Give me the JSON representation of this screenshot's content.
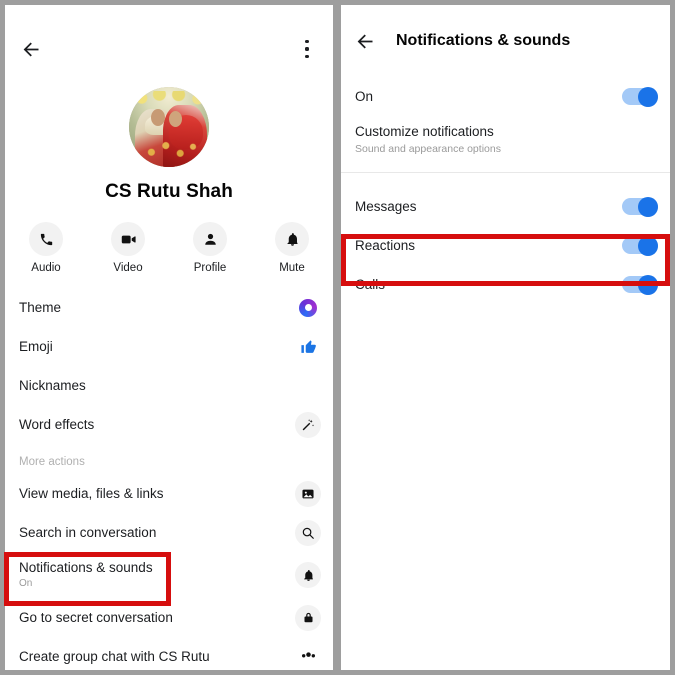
{
  "left_panel": {
    "topbar": {
      "back_icon": "arrow-left-icon",
      "overflow_icon": "more-vertical-icon"
    },
    "profile": {
      "avatar_alt": "wedding-photo-avatar",
      "name": "CS Rutu Shah"
    },
    "quick_actions": [
      {
        "label": "Audio",
        "icon": "phone-icon"
      },
      {
        "label": "Video",
        "icon": "video-camera-icon"
      },
      {
        "label": "Profile",
        "icon": "person-icon"
      },
      {
        "label": "Mute",
        "icon": "bell-icon"
      }
    ],
    "items": [
      {
        "label": "Theme",
        "icon": "theme-color-ring-icon",
        "sub": ""
      },
      {
        "label": "Emoji",
        "icon": "thumbs-up-icon",
        "sub": ""
      },
      {
        "label": "Nicknames",
        "icon": "",
        "sub": ""
      },
      {
        "label": "Word effects",
        "icon": "magic-wand-icon",
        "sub": ""
      }
    ],
    "section_label": "More actions",
    "more_items": [
      {
        "label": "View media, files & links",
        "icon": "image-icon",
        "sub": ""
      },
      {
        "label": "Search in conversation",
        "icon": "search-icon",
        "sub": ""
      },
      {
        "label": "Notifications & sounds",
        "icon": "bell-icon",
        "sub": "On"
      },
      {
        "label": "Go to secret conversation",
        "icon": "lock-icon",
        "sub": ""
      },
      {
        "label": "Create group chat with CS Rutu",
        "icon": "people-icon",
        "sub": ""
      }
    ]
  },
  "right_panel": {
    "topbar": {
      "back_icon": "arrow-left-icon",
      "title": "Notifications & sounds"
    },
    "rows": [
      {
        "label": "On",
        "sub": "",
        "toggle": true
      },
      {
        "label": "Customize notifications",
        "sub": "Sound and appearance options",
        "toggle": null
      },
      {
        "label": "Messages",
        "sub": "",
        "toggle": true
      },
      {
        "label": "Reactions",
        "sub": "",
        "toggle": true
      },
      {
        "label": "Calls",
        "sub": "",
        "toggle": true
      }
    ]
  },
  "annotations": {
    "highlight_color": "#d60e0e",
    "boxes": [
      {
        "target": "Notifications & sounds"
      },
      {
        "target": "Calls"
      }
    ]
  },
  "colors": {
    "toggle_track": "#a3c9f7",
    "toggle_thumb": "#1a73e8",
    "accent_blue": "#1a73e8",
    "frame_gray": "#9e9e9e"
  }
}
